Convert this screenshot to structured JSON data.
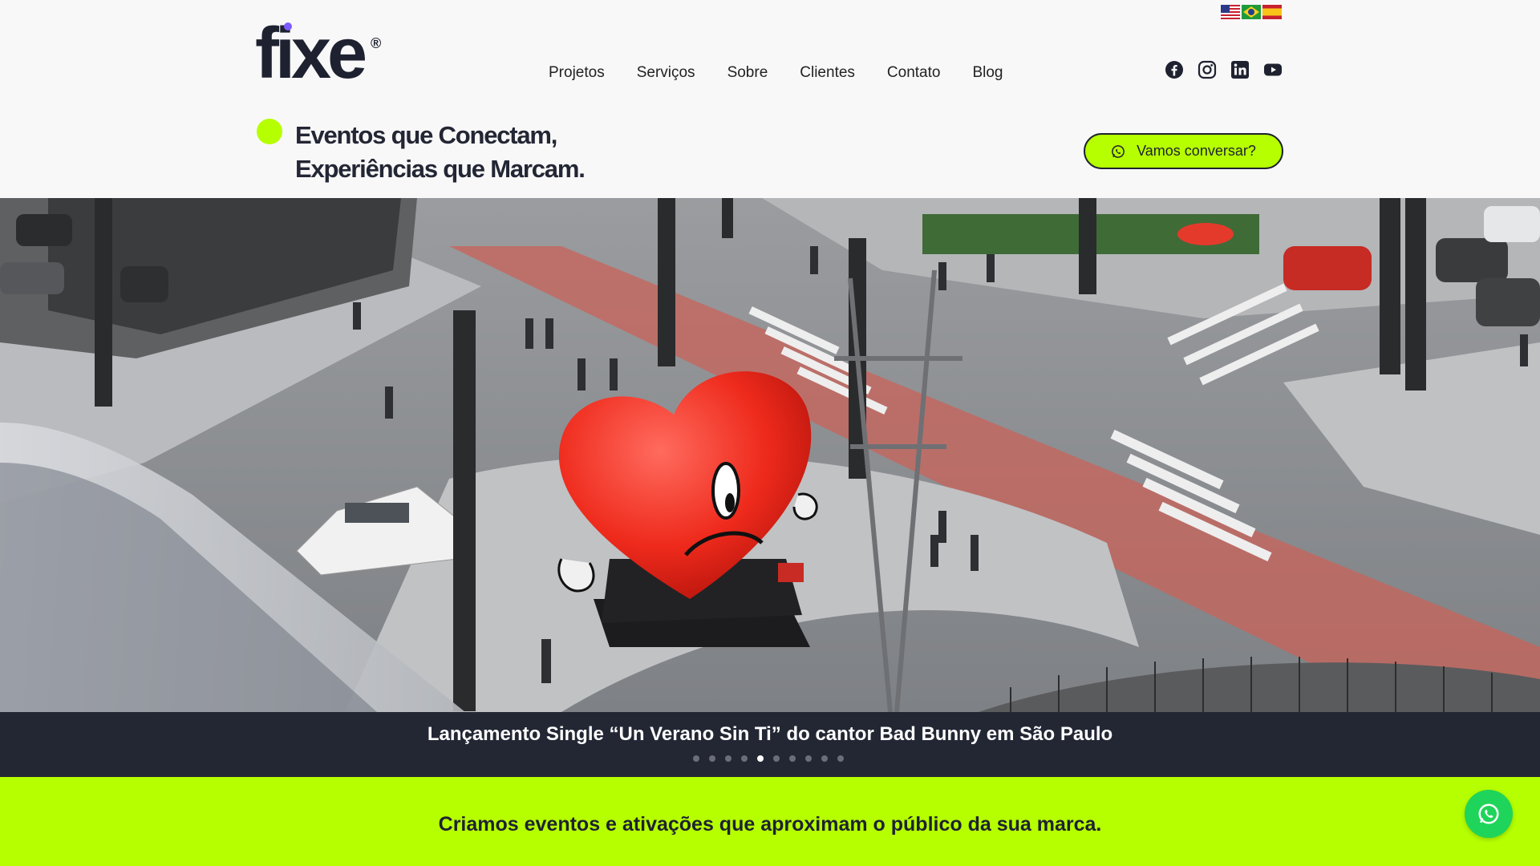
{
  "brand": {
    "logo_text": "fixe",
    "registered": "®"
  },
  "languages": [
    {
      "name": "English",
      "icon": "us-flag-icon"
    },
    {
      "name": "Português",
      "icon": "brazil-flag-icon"
    },
    {
      "name": "Español",
      "icon": "spain-flag-icon"
    }
  ],
  "nav": {
    "items": [
      "Projetos",
      "Serviços",
      "Sobre",
      "Clientes",
      "Contato",
      "Blog"
    ]
  },
  "social": [
    "facebook-icon",
    "instagram-icon",
    "linkedin-icon",
    "youtube-icon"
  ],
  "hero_heading": {
    "line1": "Eventos que Conectam,",
    "line2": "Experiências que Marcam."
  },
  "cta": {
    "label": "Vamos conversar?",
    "icon": "whatsapp-icon"
  },
  "slider": {
    "caption": "Lançamento Single “Un Verano Sin Ti” do cantor Bad Bunny em São Paulo",
    "total_slides": 10,
    "active_index": 4
  },
  "banner": {
    "text": "Criamos eventos e ativações que aproximam o público da sua marca."
  },
  "colors": {
    "accent": "#b6ff00",
    "dark": "#232734",
    "whatsapp": "#1fd45a",
    "logo_dot": "#7c5cff"
  }
}
